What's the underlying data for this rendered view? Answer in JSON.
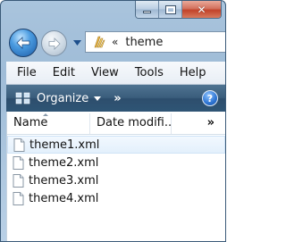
{
  "address": {
    "chevrons": "«",
    "path": "theme"
  },
  "menu": [
    "File",
    "Edit",
    "View",
    "Tools",
    "Help"
  ],
  "command_bar": {
    "organize": "Organize",
    "more": "»",
    "help": "?"
  },
  "columns": {
    "name": "Name",
    "date": "Date modifi...",
    "more": "»"
  },
  "files": [
    "theme1.xml",
    "theme2.xml",
    "theme3.xml",
    "theme4.xml"
  ],
  "colors": {
    "command_bar": "#3a5d7c",
    "hover_row": "#e3f0fc"
  },
  "icons": {
    "back": "back-arrow-icon",
    "forward": "forward-arrow-icon",
    "folder": "folder-icon",
    "help": "help-icon",
    "file": "xml-file-icon"
  }
}
